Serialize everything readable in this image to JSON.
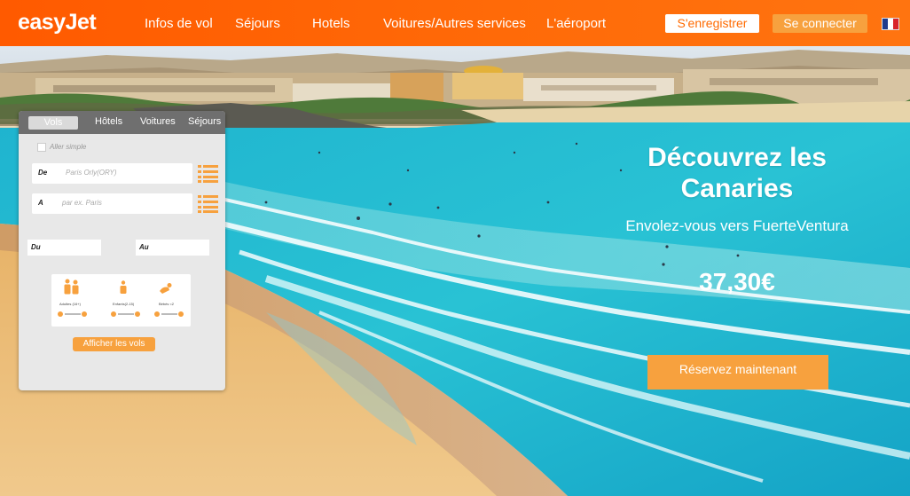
{
  "brand": {
    "logo": "easyJet",
    "accent": "#ff6600",
    "button_orange": "#f7a13e"
  },
  "header": {
    "nav": [
      "Infos de vol",
      "Séjours",
      "Hotels",
      "Voitures/Autres services",
      "L'aéroport"
    ],
    "register_label": "S'enregistrer",
    "login_label": "Se connecter",
    "language_icon": "french-flag-icon"
  },
  "booking": {
    "tabs": [
      "Vols",
      "Hôtels",
      "Voitures",
      "Séjours"
    ],
    "active_tab": "Vols",
    "one_way_label": "Aller simple",
    "from": {
      "label": "De",
      "placeholder": "Paris Orly(ORY)"
    },
    "to": {
      "label": "A",
      "placeholder": "par ex. Paris"
    },
    "depart_label": "Du",
    "return_label": "Au",
    "passengers": [
      {
        "label": "Adultes (16+)",
        "icon": "adults-icon"
      },
      {
        "label": "Enfants(2-15)",
        "icon": "child-icon"
      },
      {
        "label": "Bébés <2",
        "icon": "infant-icon"
      }
    ],
    "search_label": "Afficher les vols",
    "link_1": "",
    "link_2": ""
  },
  "promo": {
    "title_line1": "Découvrez les",
    "title_line2": "Canaries",
    "subtitle": "Envolez-vous vers FuerteVentura",
    "price": "37,30€",
    "cta_label": "Réservez maintenant"
  }
}
